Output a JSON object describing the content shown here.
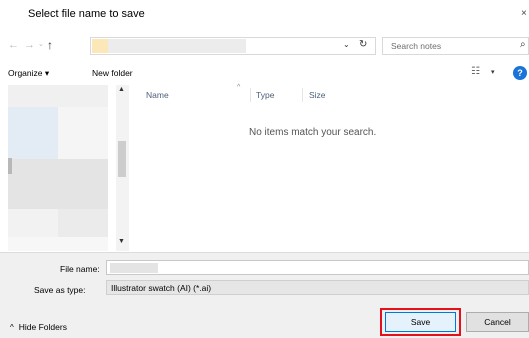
{
  "dialog": {
    "title": "Select file name to save",
    "close_glyph": "×"
  },
  "navigation": {
    "back_icon": "←",
    "forward_icon": "→",
    "recent_icon": "⌄",
    "up_icon": "↑",
    "address_chevron": "⌄",
    "refresh_icon": "↻"
  },
  "search": {
    "placeholder": "Search notes",
    "icon": "⌕"
  },
  "toolbar": {
    "organize_label": "Organize ▾",
    "new_folder_label": "New folder",
    "view_icon": "☷",
    "view_caret": "▾",
    "help_icon": "?"
  },
  "navpane": {
    "scroll_up": "▲",
    "scroll_down": "▼"
  },
  "filelist": {
    "columns": [
      "Name",
      "Type",
      "Size"
    ],
    "sort_indicator": "^",
    "empty_message": "No items match your search."
  },
  "form": {
    "file_name_label": "File name:",
    "file_name_value": "",
    "save_as_type_label": "Save as type:",
    "save_as_type_value": "Illustrator swatch (AI) (*.ai)"
  },
  "footer": {
    "hide_folders_caret": "^",
    "hide_folders_label": "Hide Folders",
    "save_label": "Save",
    "cancel_label": "Cancel"
  },
  "colors": {
    "accent": "#0078d7",
    "highlight_box": "#e3111a",
    "help_icon": "#1a73d9"
  }
}
